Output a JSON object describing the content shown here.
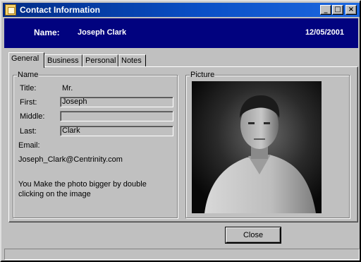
{
  "window": {
    "title": "Contact Information",
    "minimize_glyph": "_",
    "maximize_glyph": "□",
    "close_glyph": "×"
  },
  "header": {
    "name_label": "Name:",
    "name_value": "Joseph Clark",
    "date": "12/05/2001"
  },
  "tabs": [
    {
      "label": "General",
      "active": true
    },
    {
      "label": "Business",
      "active": false
    },
    {
      "label": "Personal",
      "active": false
    },
    {
      "label": "Notes",
      "active": false
    }
  ],
  "name_group": {
    "title": "Name",
    "title_label": "Title:",
    "title_value": "Mr.",
    "first_label": "First:",
    "first_value": "Joseph",
    "middle_label": "Middle:",
    "middle_value": "",
    "last_label": "Last:",
    "last_value": "Clark",
    "email_label": "Email:",
    "email_value": "Joseph_Clark@Centrinity.com",
    "hint_line1": "You Make the photo bigger by double",
    "hint_line2": "clicking on the image"
  },
  "picture_group": {
    "title": "Picture"
  },
  "buttons": {
    "close_label": "Close"
  },
  "colors": {
    "header_bg": "#01027f",
    "titlebar_start": "#002c86",
    "titlebar_end": "#1d68e0",
    "face": "#c0c0c0"
  }
}
